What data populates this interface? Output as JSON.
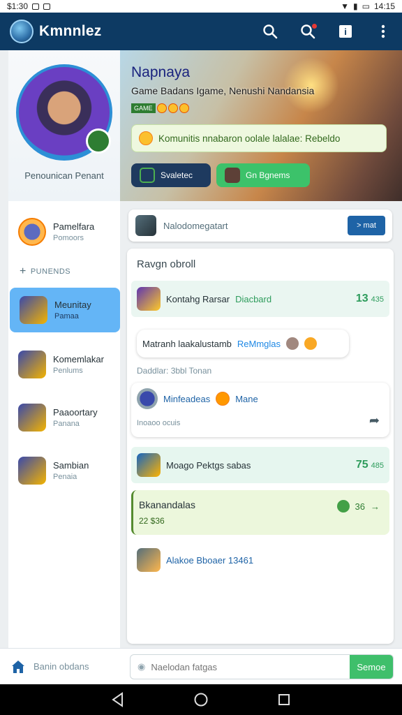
{
  "status_bar": {
    "time": "$1:30",
    "right_text": "14:15"
  },
  "app_bar": {
    "title": "Kmnnlez",
    "icons": [
      "search-icon",
      "search-alert-icon",
      "info-icon",
      "more-vert-icon"
    ]
  },
  "sidebar": {
    "profile_name": "Penounican Penant",
    "pinned": {
      "title": "Pamelfara",
      "subtitle": "Pomoors"
    },
    "section_label": "PUNENDS",
    "items": [
      {
        "title": "Meunitay",
        "subtitle": "Pamaa",
        "active": true
      },
      {
        "title": "Komemlakar",
        "subtitle": "Penlums",
        "active": false
      },
      {
        "title": "Paaoortary",
        "subtitle": "Panana",
        "active": false
      },
      {
        "title": "Sambian",
        "subtitle": "Penaia",
        "active": false
      }
    ]
  },
  "hero": {
    "title": "Napnaya",
    "subtitle": "Game Badans Igame, Nenushi Nandansia",
    "tag": "GAME",
    "banner_text": "Komunitis nnabaron oolale lalalae: Rebeldo",
    "button_1": "Svaletec",
    "button_2": "Gn Bgnems"
  },
  "compose": {
    "placeholder": "Nalodomegatart",
    "button": "> mat"
  },
  "feed": {
    "title": "Ravgn obroll",
    "row1": {
      "title": "Kontahg Rarsar",
      "accent": "Diacbard",
      "count": "13",
      "unit": "435"
    },
    "row2": {
      "text": "Matranh laakalustamb",
      "accent": "ReMmglas"
    },
    "meta": "Daddlar: 3bbl Tonan",
    "card": {
      "user": "Minfeadeas",
      "tag": "Mane",
      "sub": "Inoaoo ocuis"
    },
    "row4": {
      "title": "Moago Pektgs sabas",
      "count": "75",
      "unit": "485"
    },
    "row5": {
      "title": "Bkanandalas",
      "sub": "22 $36",
      "right": "36"
    },
    "row6": {
      "title": "Alakoe Bboaer 13461"
    }
  },
  "bottom_bar": {
    "label": "Banin obdans",
    "placeholder": "Naelodan fatgas",
    "send": "Semoe"
  },
  "colors": {
    "app_bar": "#0d3a63",
    "accent_green": "#3fbf6b",
    "accent_blue": "#64b5f6"
  }
}
